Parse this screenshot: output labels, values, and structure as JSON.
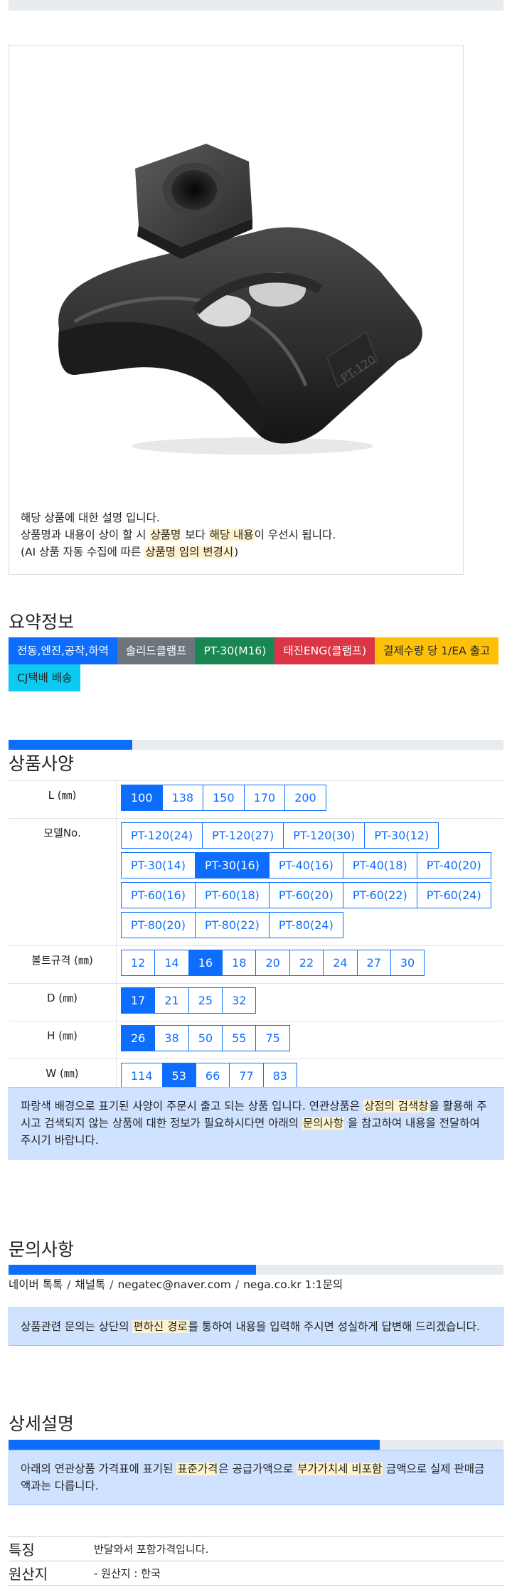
{
  "image_desc": {
    "line1": "해당 상품에 대한 설명 입니다.",
    "line2_pre": "상품명과 내용이 상이 할 시 ",
    "line2_hl1": "상품명",
    "line2_mid": " 보다 ",
    "line2_hl2": "해당 내용",
    "line2_post": "이 우선시 됩니다.",
    "line3_pre": "(AI 상품 자동 수집에 따른 ",
    "line3_hl": "상품명 임의 변경시",
    "line3_post": ")",
    "product_marking": "PT-120"
  },
  "summary": {
    "title": "요약정보",
    "badges": [
      {
        "label": "전동,엔진,공작,하역",
        "bg": "#0d6efd",
        "fg": "#ffffff"
      },
      {
        "label": "솔리드클램프",
        "bg": "#6c757d",
        "fg": "#ffffff"
      },
      {
        "label": "PT-30(M16)",
        "bg": "#198754",
        "fg": "#ffffff"
      },
      {
        "label": "태진ENG(클램프)",
        "bg": "#dc3545",
        "fg": "#ffffff"
      },
      {
        "label": "결제수량 당 1/EA 출고",
        "bg": "#ffc107",
        "fg": "#212529"
      },
      {
        "label": "CJ택배 배송",
        "bg": "#0dcaf0",
        "fg": "#212529"
      }
    ]
  },
  "spec": {
    "title": "상품사양",
    "progress": 0.25,
    "rows": [
      {
        "label": "L (㎜)",
        "options": [
          "100",
          "138",
          "150",
          "170",
          "200"
        ],
        "selected": "100"
      },
      {
        "label": "모델No.",
        "options": [
          "PT-120(24)",
          "PT-120(27)",
          "PT-120(30)",
          "PT-30(12)",
          "PT-30(14)",
          "PT-30(16)",
          "PT-40(16)",
          "PT-40(18)",
          "PT-40(20)",
          "PT-60(16)",
          "PT-60(18)",
          "PT-60(20)",
          "PT-60(22)",
          "PT-60(24)",
          "PT-80(20)",
          "PT-80(22)",
          "PT-80(24)"
        ],
        "selected": "PT-30(16)"
      },
      {
        "label": "볼트규격 (㎜)",
        "options": [
          "12",
          "14",
          "16",
          "18",
          "20",
          "22",
          "24",
          "27",
          "30"
        ],
        "selected": "16"
      },
      {
        "label": "D (㎜)",
        "options": [
          "17",
          "21",
          "25",
          "32"
        ],
        "selected": "17"
      },
      {
        "label": "H (㎜)",
        "options": [
          "26",
          "38",
          "50",
          "55",
          "75"
        ],
        "selected": "26"
      },
      {
        "label": "W (㎜)",
        "options": [
          "114",
          "53",
          "66",
          "77",
          "83"
        ],
        "selected": "53"
      }
    ],
    "notice_pre": "파랑색 배경으로 표기된 사양이 주문시 출고 되는 상품 입니다. 연관상품은 ",
    "notice_hl1": "상점의 검색창",
    "notice_mid": "을 활용해 주시고 검색되지 않는 상품에 대한 정보가 필요하시다면 아래의 ",
    "notice_hl2": "문의사항",
    "notice_post": " 을 참고하여 내용을 전달하여 주시기 바랍니다."
  },
  "inquiry": {
    "title": "문의사항",
    "progress": 0.5,
    "contacts": [
      "네이버 톡톡",
      "채널톡",
      "negatec@naver.com",
      "nega.co.kr 1:1문의"
    ],
    "notice_pre": "상품관련 문의는 상단의 ",
    "notice_hl": "편하신 경로",
    "notice_post": "를 통하여 내용을 입력해 주시면 성실하게 답변해 드리겠습니다."
  },
  "detail": {
    "title": "상세설명",
    "progress": 0.75,
    "notice_pre": "아래의 연관상품 가격표에 표기된 ",
    "notice_hl1": "표준가격",
    "notice_mid": "은 공급가액으로 ",
    "notice_hl2": "부가가치세 비포함",
    "notice_post": " 금액으로 실제 판매금액과는 다릅니다.",
    "rows": [
      {
        "label": "특징",
        "value": "반달와셔 포함가격입니다."
      },
      {
        "label": "원산지",
        "value": "- 원산지 : 한국"
      }
    ]
  }
}
